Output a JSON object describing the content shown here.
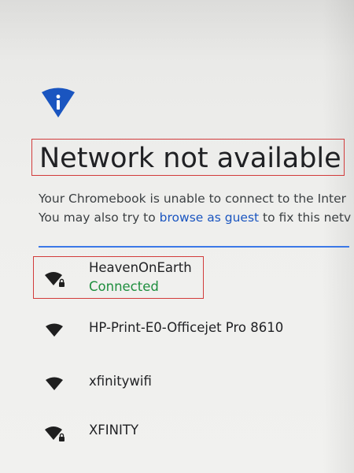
{
  "header": {
    "icon": "info-wifi-icon",
    "title": "Network not available"
  },
  "description": {
    "line1": "Your Chromebook is unable to connect to the Inter",
    "line2_prefix": "You may also try to ",
    "line2_link": "browse as guest",
    "line2_suffix": " to fix this netv"
  },
  "networks": [
    {
      "name": "HeavenOnEarth",
      "status": "Connected",
      "icon": "wifi-secured-icon",
      "secured": true
    },
    {
      "name": "HP-Print-E0-Officejet Pro 8610",
      "icon": "wifi-icon",
      "secured": false
    },
    {
      "name": "xfinitywifi",
      "icon": "wifi-icon",
      "secured": false
    },
    {
      "name": "XFINITY",
      "icon": "wifi-secured-icon",
      "secured": true
    }
  ],
  "colors": {
    "accent": "#1a55c0",
    "connected": "#1e8e3e",
    "highlight": "#d23b3b"
  }
}
